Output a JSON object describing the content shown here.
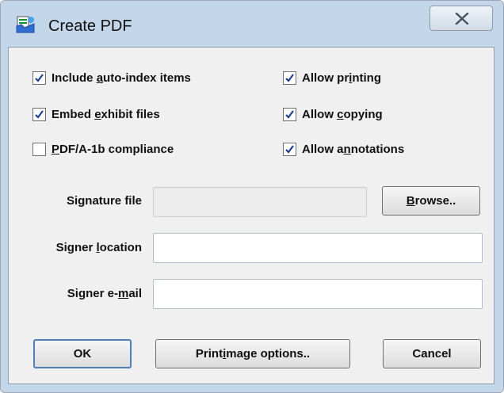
{
  "window": {
    "title": "Create PDF"
  },
  "checkboxes": [
    {
      "pre": "Include ",
      "acc": "a",
      "post": "uto-index items",
      "checked": true
    },
    {
      "pre": "Embed ",
      "acc": "e",
      "post": "xhibit files",
      "checked": true
    },
    {
      "pre": "",
      "acc": "P",
      "post": "DF/A-1b compliance",
      "checked": false
    },
    {
      "pre": "Allow pr",
      "acc": "i",
      "post": "nting",
      "checked": true
    },
    {
      "pre": "Allow ",
      "acc": "c",
      "post": "opying",
      "checked": true
    },
    {
      "pre": "Allow a",
      "acc": "n",
      "post": "notations",
      "checked": true
    }
  ],
  "fields": {
    "signature": {
      "label": "Signature file",
      "value": ""
    },
    "location": {
      "pre": "Signer ",
      "acc": "l",
      "post": "ocation",
      "value": ""
    },
    "email": {
      "pre": "Signer e-",
      "acc": "m",
      "post": "ail",
      "value": ""
    }
  },
  "buttons": {
    "browse": {
      "acc": "B",
      "post": "rowse.."
    },
    "ok": {
      "label": "OK"
    },
    "print_options": {
      "pre": "Print ",
      "acc": "i",
      "post": "mage options.."
    },
    "cancel": {
      "label": "Cancel"
    }
  },
  "icons": {
    "app": "pdf-app-icon",
    "close": "close-icon",
    "check": "checkmark-icon"
  },
  "colors": {
    "titlebar": "#c4d7ea",
    "client": "#f0f0f0",
    "check": "#1c3f8f"
  }
}
